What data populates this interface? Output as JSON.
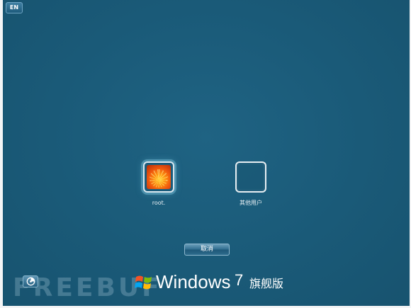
{
  "language_badge": "EN",
  "users": [
    {
      "name": "root."
    },
    {
      "name": "其他用户"
    }
  ],
  "cancel_label": "取消",
  "ease_of_access_icon": "ease-of-access-icon",
  "brand": {
    "product": "Windows",
    "version": "7",
    "edition": "旗舰版"
  },
  "watermark": "FREEBUF",
  "colors": {
    "background": "#1a5a78",
    "button": "#2e6c8e",
    "text": "#ffffff"
  }
}
